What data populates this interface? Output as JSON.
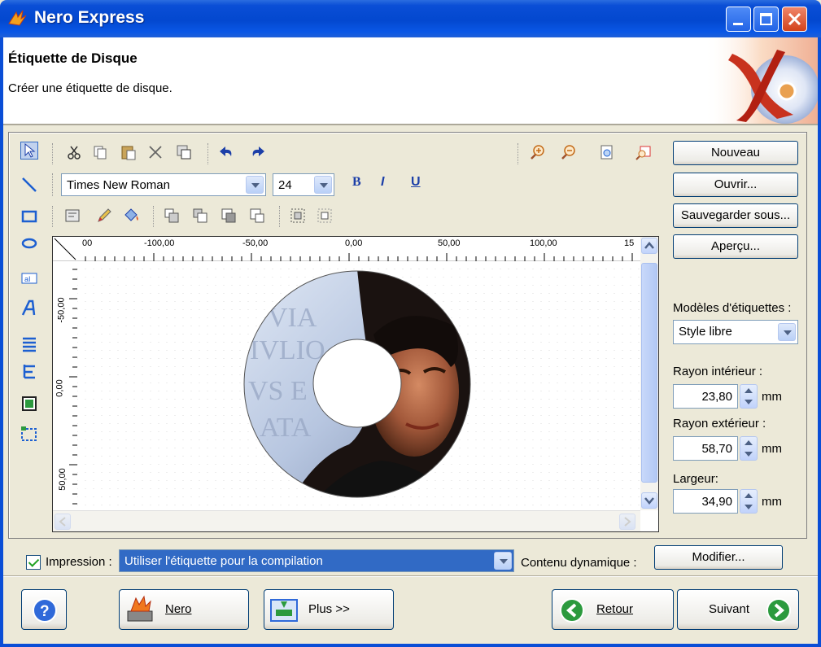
{
  "window": {
    "title": "Nero Express"
  },
  "header": {
    "title": "Étiquette de Disque",
    "subtitle": "Créer une étiquette de disque."
  },
  "toolbar": {
    "font_name": "Times New Roman",
    "font_size": "24",
    "bold": "B",
    "italic": "I",
    "underline": "U"
  },
  "rulers": {
    "top": [
      "00",
      "-100,00",
      "-50,00",
      "0,00",
      "50,00",
      "100,00",
      "15"
    ],
    "left": [
      "-50,00",
      "0,00",
      "50,00"
    ]
  },
  "right_panel": {
    "new_button": "Nouveau",
    "open_button": "Ouvrir...",
    "save_as_button": "Sauvegarder sous...",
    "preview_button": "Aperçu...",
    "templates_label": "Modèles d'étiquettes :",
    "template_value": "Style libre",
    "inner_radius_label": "Rayon intérieur :",
    "inner_radius_value": "23,80",
    "outer_radius_label": "Rayon extérieur :",
    "outer_radius_value": "58,70",
    "width_label": "Largeur:",
    "width_value": "34,90",
    "unit": "mm"
  },
  "bottom": {
    "print_label": "Impression :",
    "print_option": "Utiliser l'étiquette pour la compilation",
    "dynamic_label": "Contenu dynamique :",
    "modify_button": "Modifier..."
  },
  "nav": {
    "nero": "Nero",
    "more": "Plus >>",
    "back": "Retour",
    "next": "Suivant"
  },
  "colors": {
    "titlebar": "#0a4ed6",
    "dialog_bg": "#ece9d8",
    "logo_red": "#c8321e"
  }
}
